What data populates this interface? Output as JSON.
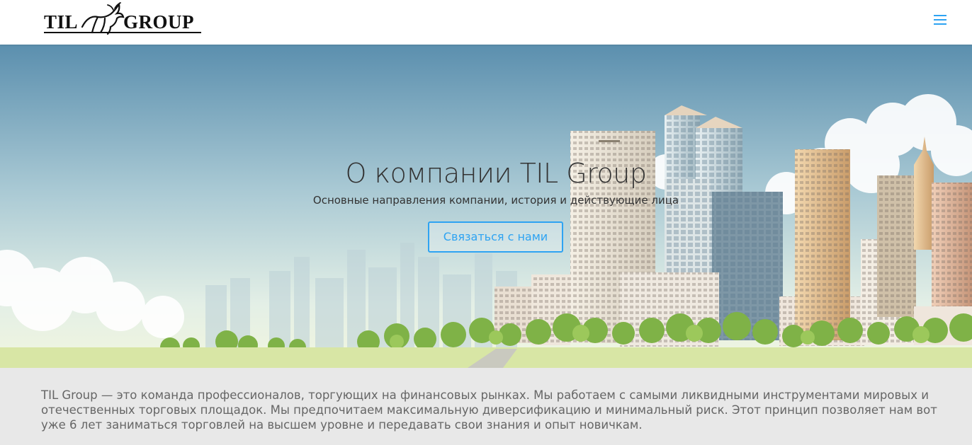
{
  "header": {
    "logo": {
      "left_text": "TIL",
      "right_text": "GROUP"
    },
    "menu_icon": "hamburger-menu-icon"
  },
  "hero": {
    "title": "О компании TIL Group",
    "subtitle": "Основные направления компании, история и действующие лица",
    "cta_label": "Связаться с нами",
    "illustration": "city-skyline-illustration"
  },
  "about": {
    "text": "TIL Group — это команда профессионалов, торгующих на финансовых рынках. Мы работаем с самыми ликвидными инструментами мировых и отечественных торговых площадок. Мы предпочитаем максимальную диверсификацию и минимальный риск. Этот принцип позволяет нам вот уже 6 лет заниматься торговлей на высшем уровне и  передавать свои знания и опыт новичкам."
  },
  "colors": {
    "accent": "#2ea3f2",
    "sky_top": "#5b8fae",
    "grass": "#d8e6a5",
    "section_bg": "#e8e8e8"
  }
}
